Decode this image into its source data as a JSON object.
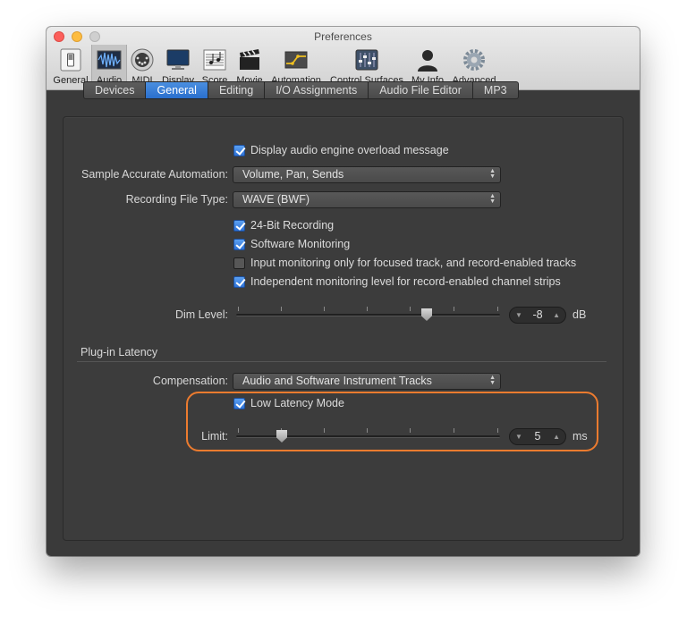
{
  "window": {
    "title": "Preferences"
  },
  "toolbar": [
    {
      "label": "General"
    },
    {
      "label": "Audio"
    },
    {
      "label": "MIDI"
    },
    {
      "label": "Display"
    },
    {
      "label": "Score"
    },
    {
      "label": "Movie"
    },
    {
      "label": "Automation"
    },
    {
      "label": "Control Surfaces"
    },
    {
      "label": "My Info"
    },
    {
      "label": "Advanced"
    }
  ],
  "tabs": [
    "Devices",
    "General",
    "Editing",
    "I/O Assignments",
    "Audio File Editor",
    "MP3"
  ],
  "active_tab": "General",
  "general": {
    "overload_message": {
      "label": "Display audio engine overload message",
      "checked": true
    },
    "sample_accurate_automation": {
      "label": "Sample Accurate Automation:",
      "value": "Volume, Pan, Sends"
    },
    "recording_file_type": {
      "label": "Recording File Type:",
      "value": "WAVE (BWF)"
    },
    "bit24": {
      "label": "24-Bit Recording",
      "checked": true
    },
    "software_monitoring": {
      "label": "Software Monitoring",
      "checked": true
    },
    "input_monitoring": {
      "label": "Input monitoring only for focused track, and record-enabled tracks",
      "checked": false
    },
    "independent_monitoring": {
      "label": "Independent monitoring level for record-enabled channel strips",
      "checked": true
    },
    "dim_level": {
      "label": "Dim Level:",
      "value": "-8",
      "unit": "dB"
    }
  },
  "plugin_latency": {
    "heading": "Plug-in Latency",
    "compensation": {
      "label": "Compensation:",
      "value": "Audio and Software Instrument Tracks"
    },
    "low_latency_mode": {
      "label": "Low Latency Mode",
      "checked": true
    },
    "limit": {
      "label": "Limit:",
      "value": "5",
      "unit": "ms"
    }
  },
  "colors": {
    "accent": "#2a6fcd",
    "highlight": "#ec7b2f"
  }
}
